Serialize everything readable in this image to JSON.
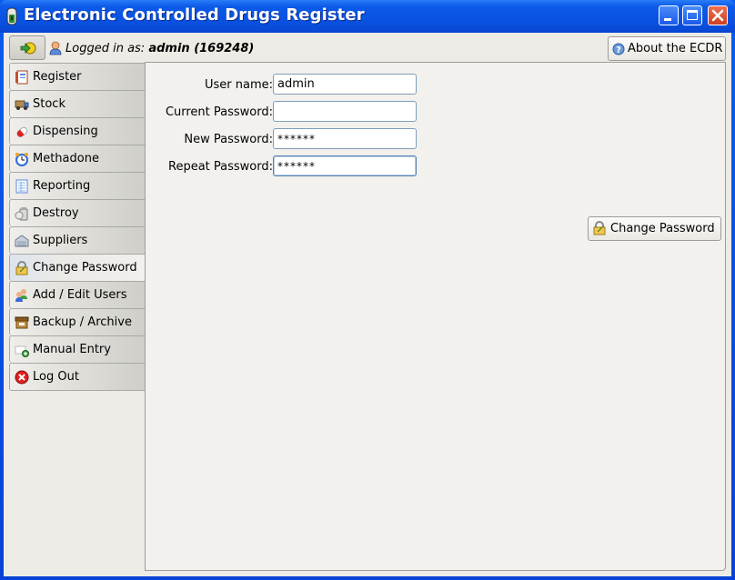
{
  "window": {
    "title": "Electronic Controlled Drugs Register",
    "controls": [
      "minimize",
      "maximize",
      "close"
    ]
  },
  "header": {
    "logged_in_label": "Logged in as:",
    "logged_in_user": "admin (169248)",
    "about_button": "About the ECDR"
  },
  "sidebar": {
    "items": [
      {
        "label": "Register",
        "icon": "notebook-icon",
        "active": false
      },
      {
        "label": "Stock",
        "icon": "truck-icon",
        "active": false
      },
      {
        "label": "Dispensing",
        "icon": "pill-icon",
        "active": false
      },
      {
        "label": "Methadone",
        "icon": "alarm-clock-icon",
        "active": false
      },
      {
        "label": "Reporting",
        "icon": "report-sheet-icon",
        "active": false
      },
      {
        "label": "Destroy",
        "icon": "bin-icon",
        "active": false
      },
      {
        "label": "Suppliers",
        "icon": "warehouse-icon",
        "active": false
      },
      {
        "label": "Change Password",
        "icon": "padlock-edit-icon",
        "active": true
      },
      {
        "label": "Add / Edit Users",
        "icon": "users-add-icon",
        "active": false
      },
      {
        "label": "Backup / Archive",
        "icon": "archive-box-icon",
        "active": false
      },
      {
        "label": "Manual Entry",
        "icon": "card-add-icon",
        "active": false
      },
      {
        "label": "Log Out",
        "icon": "red-x-icon",
        "active": false
      }
    ]
  },
  "form": {
    "username_label": "User name:",
    "username_value": "admin",
    "current_password_label": "Current Password:",
    "current_password_value": "",
    "new_password_label": "New Password:",
    "new_password_value": "******",
    "repeat_password_label": "Repeat Password:",
    "repeat_password_value": "******",
    "submit_label": "Change Password"
  }
}
